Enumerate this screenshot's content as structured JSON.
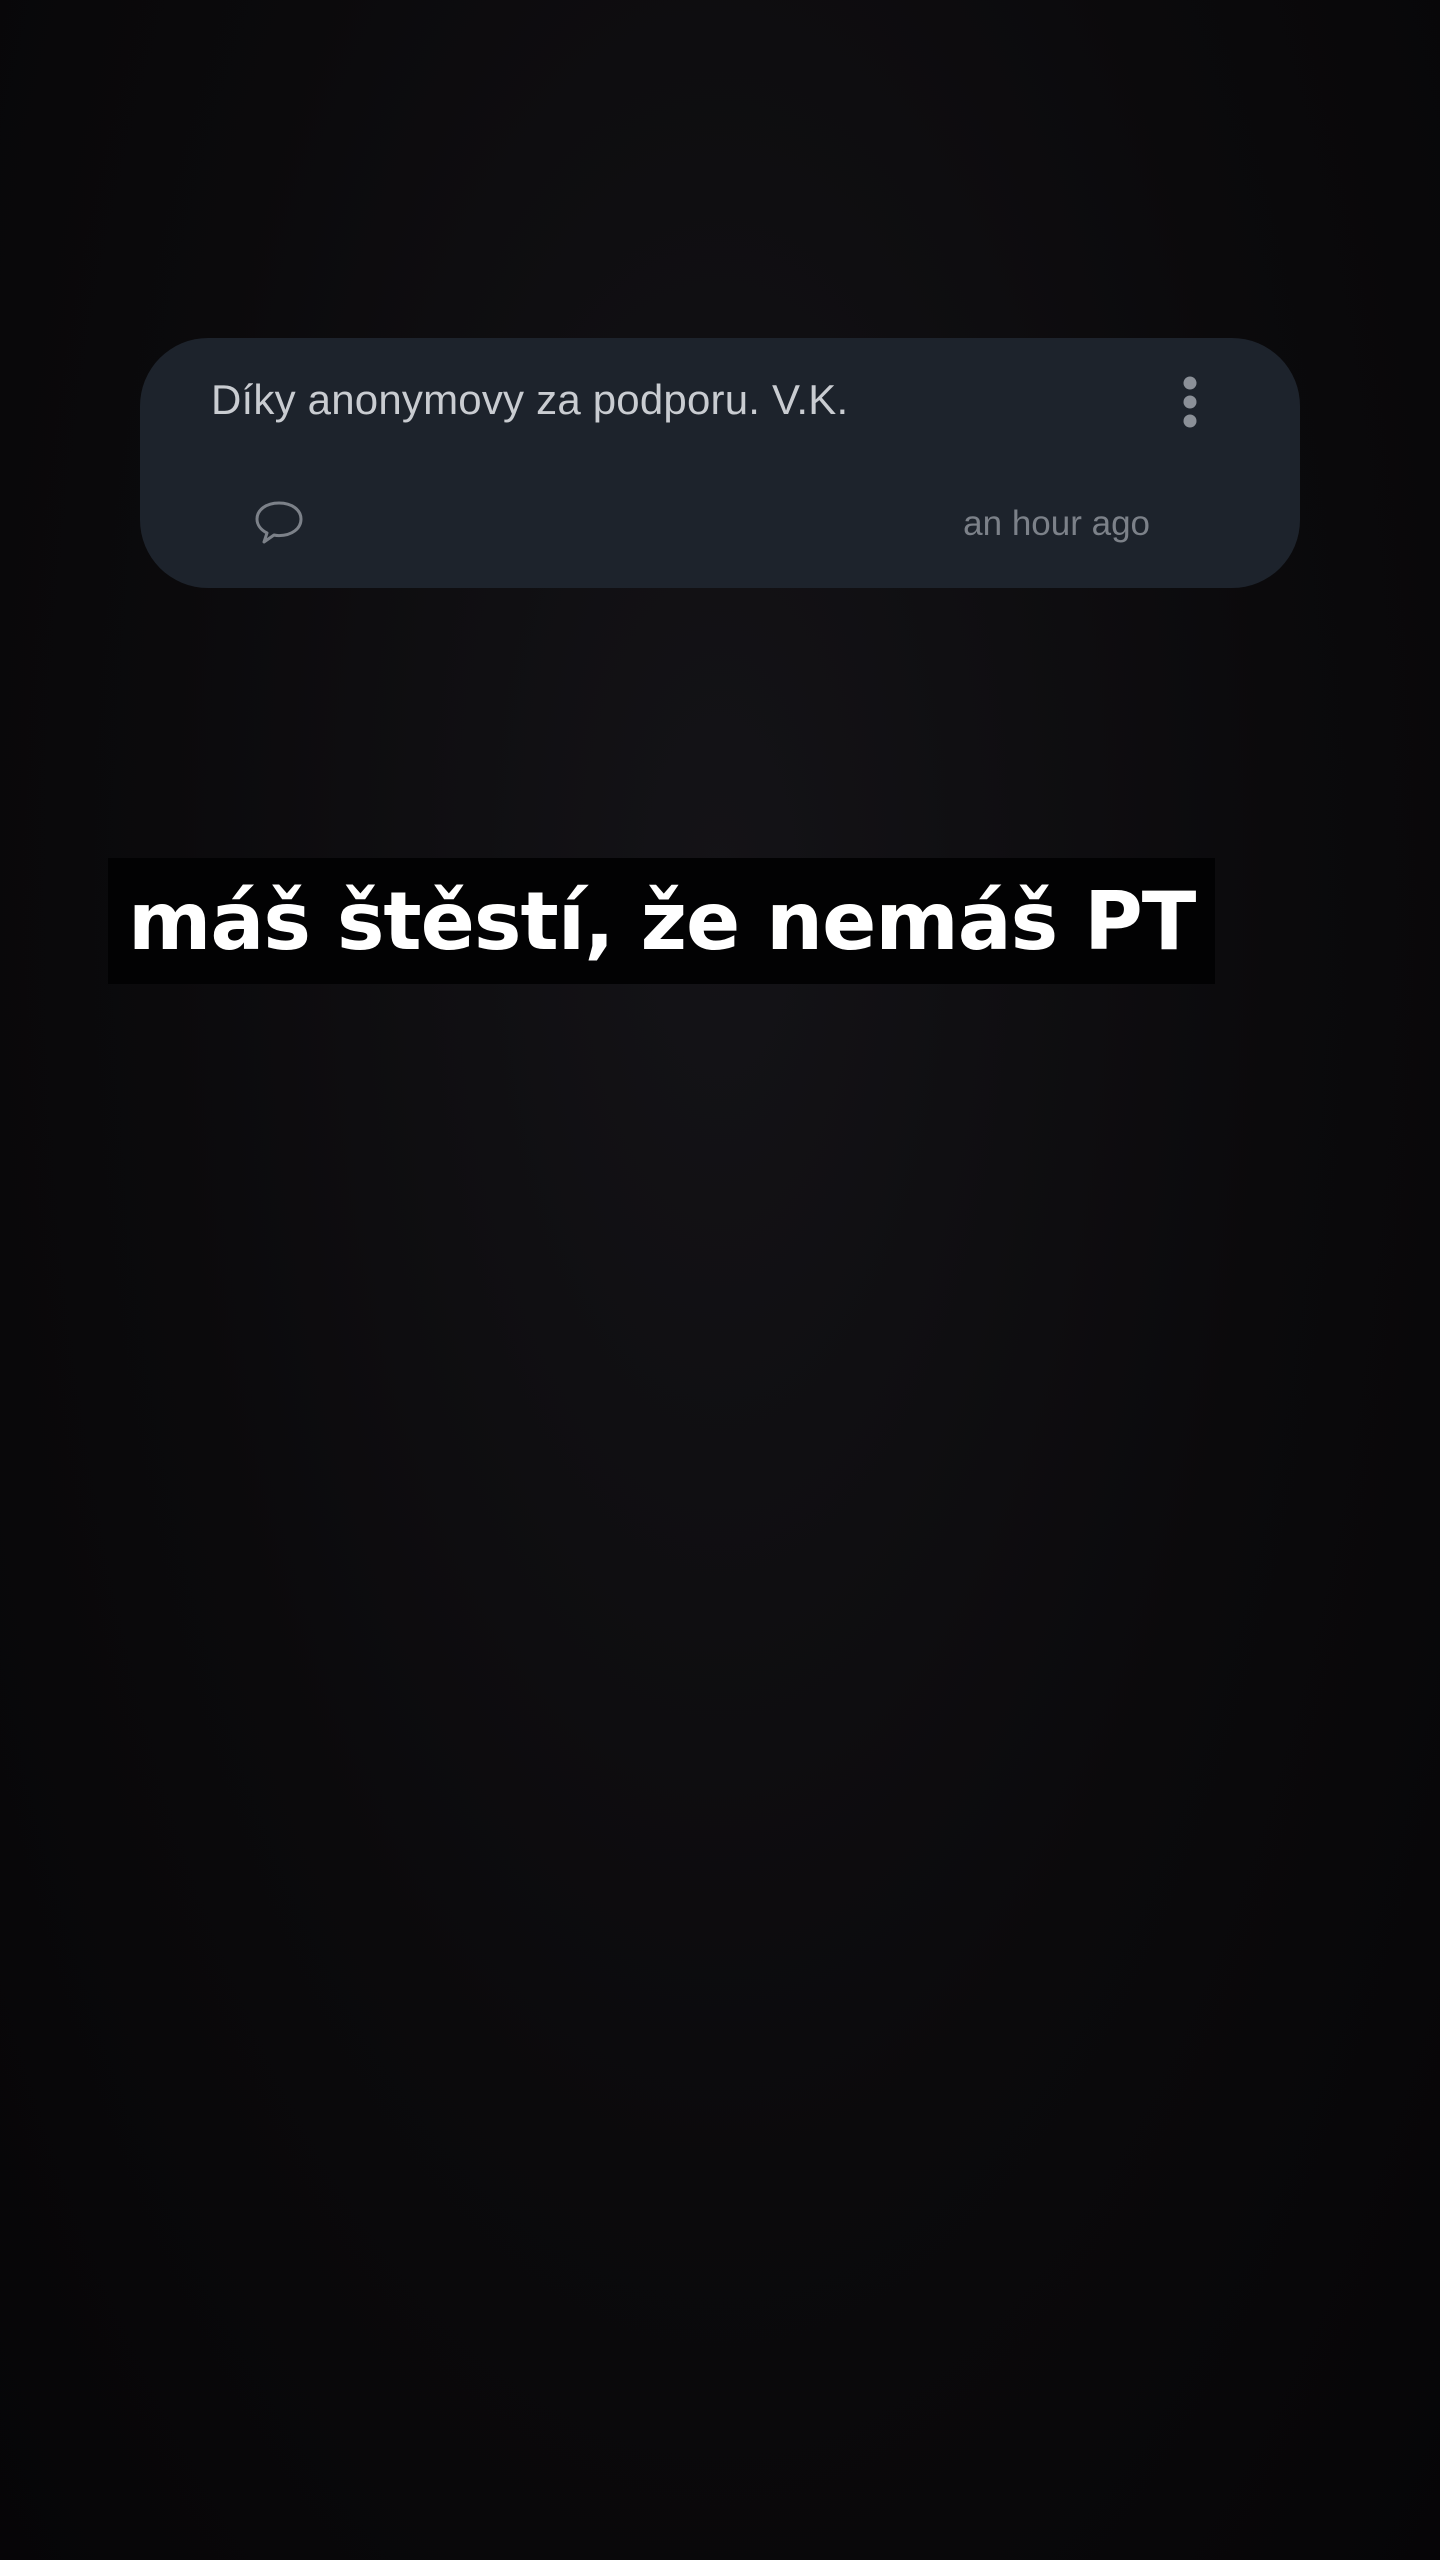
{
  "comment": {
    "text": "Díky anonymovy za podporu. V.K.",
    "timestamp": "an hour ago",
    "reply_icon": "speech-bubble-icon",
    "menu_icon": "more-vertical-icon"
  },
  "caption": {
    "text": "máš štěstí, že nemáš PT"
  },
  "colors": {
    "background": "#0d0c0e",
    "card": "#1d232c",
    "comment_text": "#c9ccd1",
    "timestamp": "#7c8189",
    "caption_bg": "#020203",
    "caption_text": "#ffffff"
  }
}
